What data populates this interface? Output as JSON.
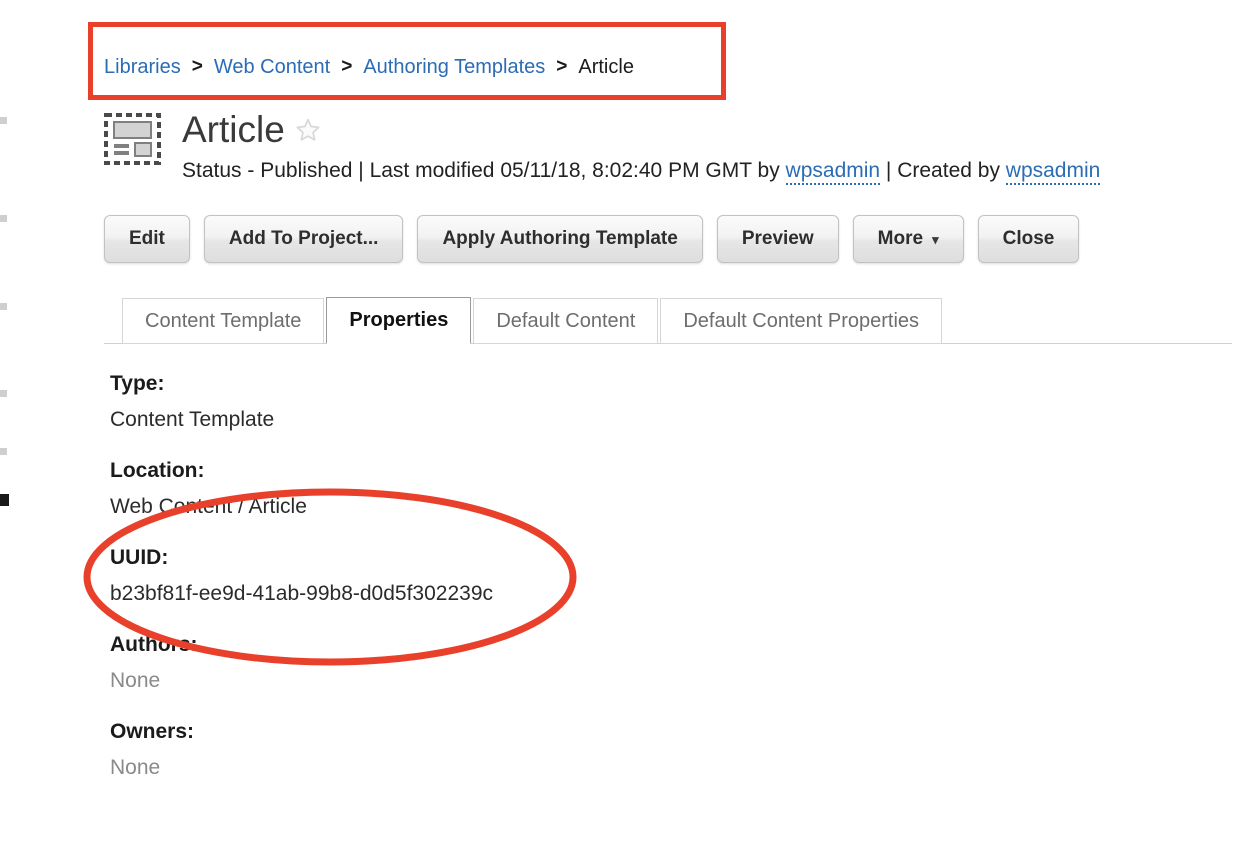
{
  "breadcrumb": {
    "separator": ">",
    "items": [
      {
        "label": "Libraries",
        "link": true
      },
      {
        "label": "Web Content",
        "link": true
      },
      {
        "label": "Authoring Templates",
        "link": true
      },
      {
        "label": "Article",
        "link": false
      }
    ]
  },
  "header": {
    "icon": "content-template-icon",
    "title": "Article",
    "favorite_icon": "star-outline-icon",
    "status": {
      "status_prefix": "Status - ",
      "status_value": "Published",
      "separator_1": " | ",
      "modified_prefix": "Last modified ",
      "modified_value": "05/11/18, 8:02:40 PM GMT",
      "modified_by_prefix": " by ",
      "modified_by_user": "wpsadmin",
      "separator_2": " | ",
      "created_prefix": "Created by ",
      "created_by_user": "wpsadmin"
    }
  },
  "actions": [
    {
      "label": "Edit",
      "name": "edit-button",
      "caret": false
    },
    {
      "label": "Add To Project...",
      "name": "add-to-project-button",
      "caret": false
    },
    {
      "label": "Apply Authoring Template",
      "name": "apply-authoring-template-button",
      "caret": false
    },
    {
      "label": "Preview",
      "name": "preview-button",
      "caret": false
    },
    {
      "label": "More",
      "name": "more-button",
      "caret": true,
      "caret_glyph": "▾"
    },
    {
      "label": "Close",
      "name": "close-button",
      "caret": false
    }
  ],
  "tabs": [
    {
      "label": "Content Template",
      "name": "tab-content-template",
      "active": false
    },
    {
      "label": "Properties",
      "name": "tab-properties",
      "active": true
    },
    {
      "label": "Default Content",
      "name": "tab-default-content",
      "active": false
    },
    {
      "label": "Default Content Properties",
      "name": "tab-default-content-properties",
      "active": false
    }
  ],
  "properties": [
    {
      "label": "Type:",
      "value": "Content Template",
      "muted": false,
      "name": "property-type"
    },
    {
      "label": "Location:",
      "value": "Web Content / Article",
      "muted": false,
      "name": "property-location"
    },
    {
      "label": "UUID:",
      "value": "b23bf81f-ee9d-41ab-99b8-d0d5f302239c",
      "muted": false,
      "name": "property-uuid"
    },
    {
      "label": "Authors:",
      "value": "None",
      "muted": true,
      "name": "property-authors"
    },
    {
      "label": "Owners:",
      "value": "None",
      "muted": true,
      "name": "property-owners"
    }
  ],
  "annotations": {
    "color": "#e8402a",
    "rectangle_target": "breadcrumb",
    "ellipse_target": "uuid"
  },
  "theme": {
    "link_color": "#2b6cb5",
    "text_color": "#222222",
    "muted_text_color": "#8a8a8a",
    "annotation_red": "#e8402a"
  }
}
